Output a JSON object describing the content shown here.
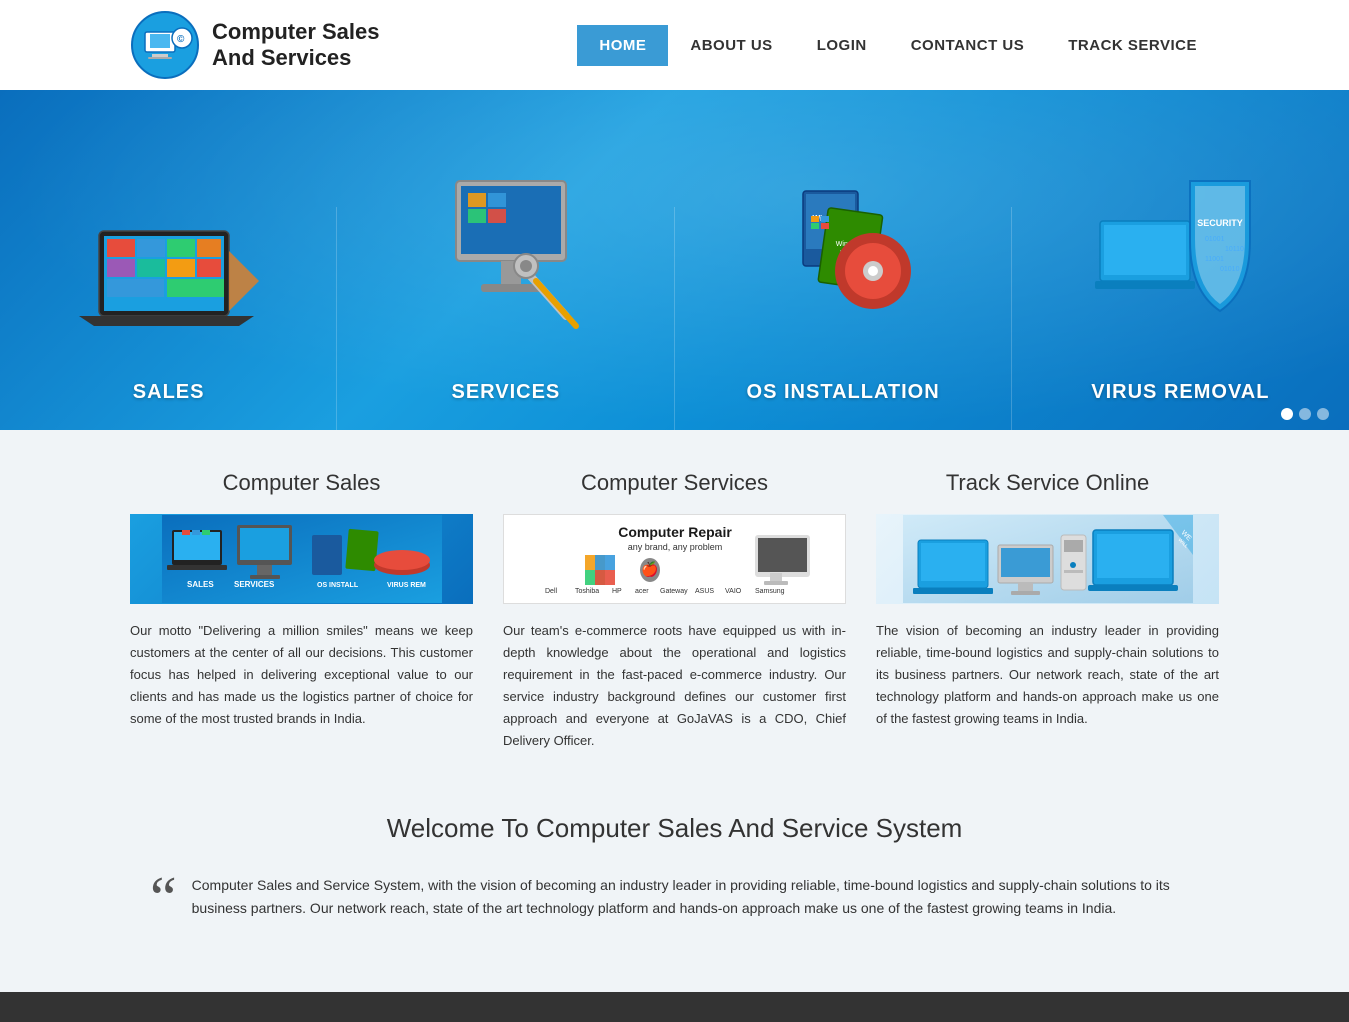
{
  "site": {
    "name_line1": "Computer Sales",
    "name_line2": "And Services"
  },
  "nav": {
    "items": [
      {
        "label": "HOME",
        "active": true
      },
      {
        "label": "ABOUT US",
        "active": false
      },
      {
        "label": "LOGIN",
        "active": false
      },
      {
        "label": "CONTANCT US",
        "active": false
      },
      {
        "label": "TRACK SERVICE",
        "active": false
      }
    ]
  },
  "hero": {
    "columns": [
      {
        "label": "SALES"
      },
      {
        "label": "SERVICES"
      },
      {
        "label": "OS INSTALLATION"
      },
      {
        "label": "VIRUS REMOVAL"
      }
    ]
  },
  "sections": {
    "computer_sales": {
      "title": "Computer Sales",
      "text": "Our motto \"Delivering a million smiles\" means we keep customers at the center of all our decisions. This customer focus has helped in delivering exceptional value to our clients and has made us the logistics partner of choice for some of the most trusted brands in India."
    },
    "computer_services": {
      "title": "Computer Services",
      "text": "Our team's e-commerce roots have equipped us with in-depth knowledge about the operational and logistics requirement in the fast-paced e-commerce industry. Our service industry background defines our customer first approach and everyone at GoJaVAS is a CDO, Chief Delivery Officer."
    },
    "track_service": {
      "title": "Track Service Online",
      "text": "The vision of becoming an industry leader in providing reliable, time-bound logistics and supply-chain solutions to its business partners. Our network reach, state of the art technology platform and hands-on approach make us one of the fastest growing teams in India."
    }
  },
  "welcome": {
    "title": "Welcome To Computer Sales And Service System",
    "quote": "Computer Sales and Service System, with the vision of becoming an industry leader in providing reliable, time-bound logistics and supply-chain solutions to its business partners. Our network reach, state of the art technology platform and hands-on approach make us one of the fastest growing teams in India."
  }
}
